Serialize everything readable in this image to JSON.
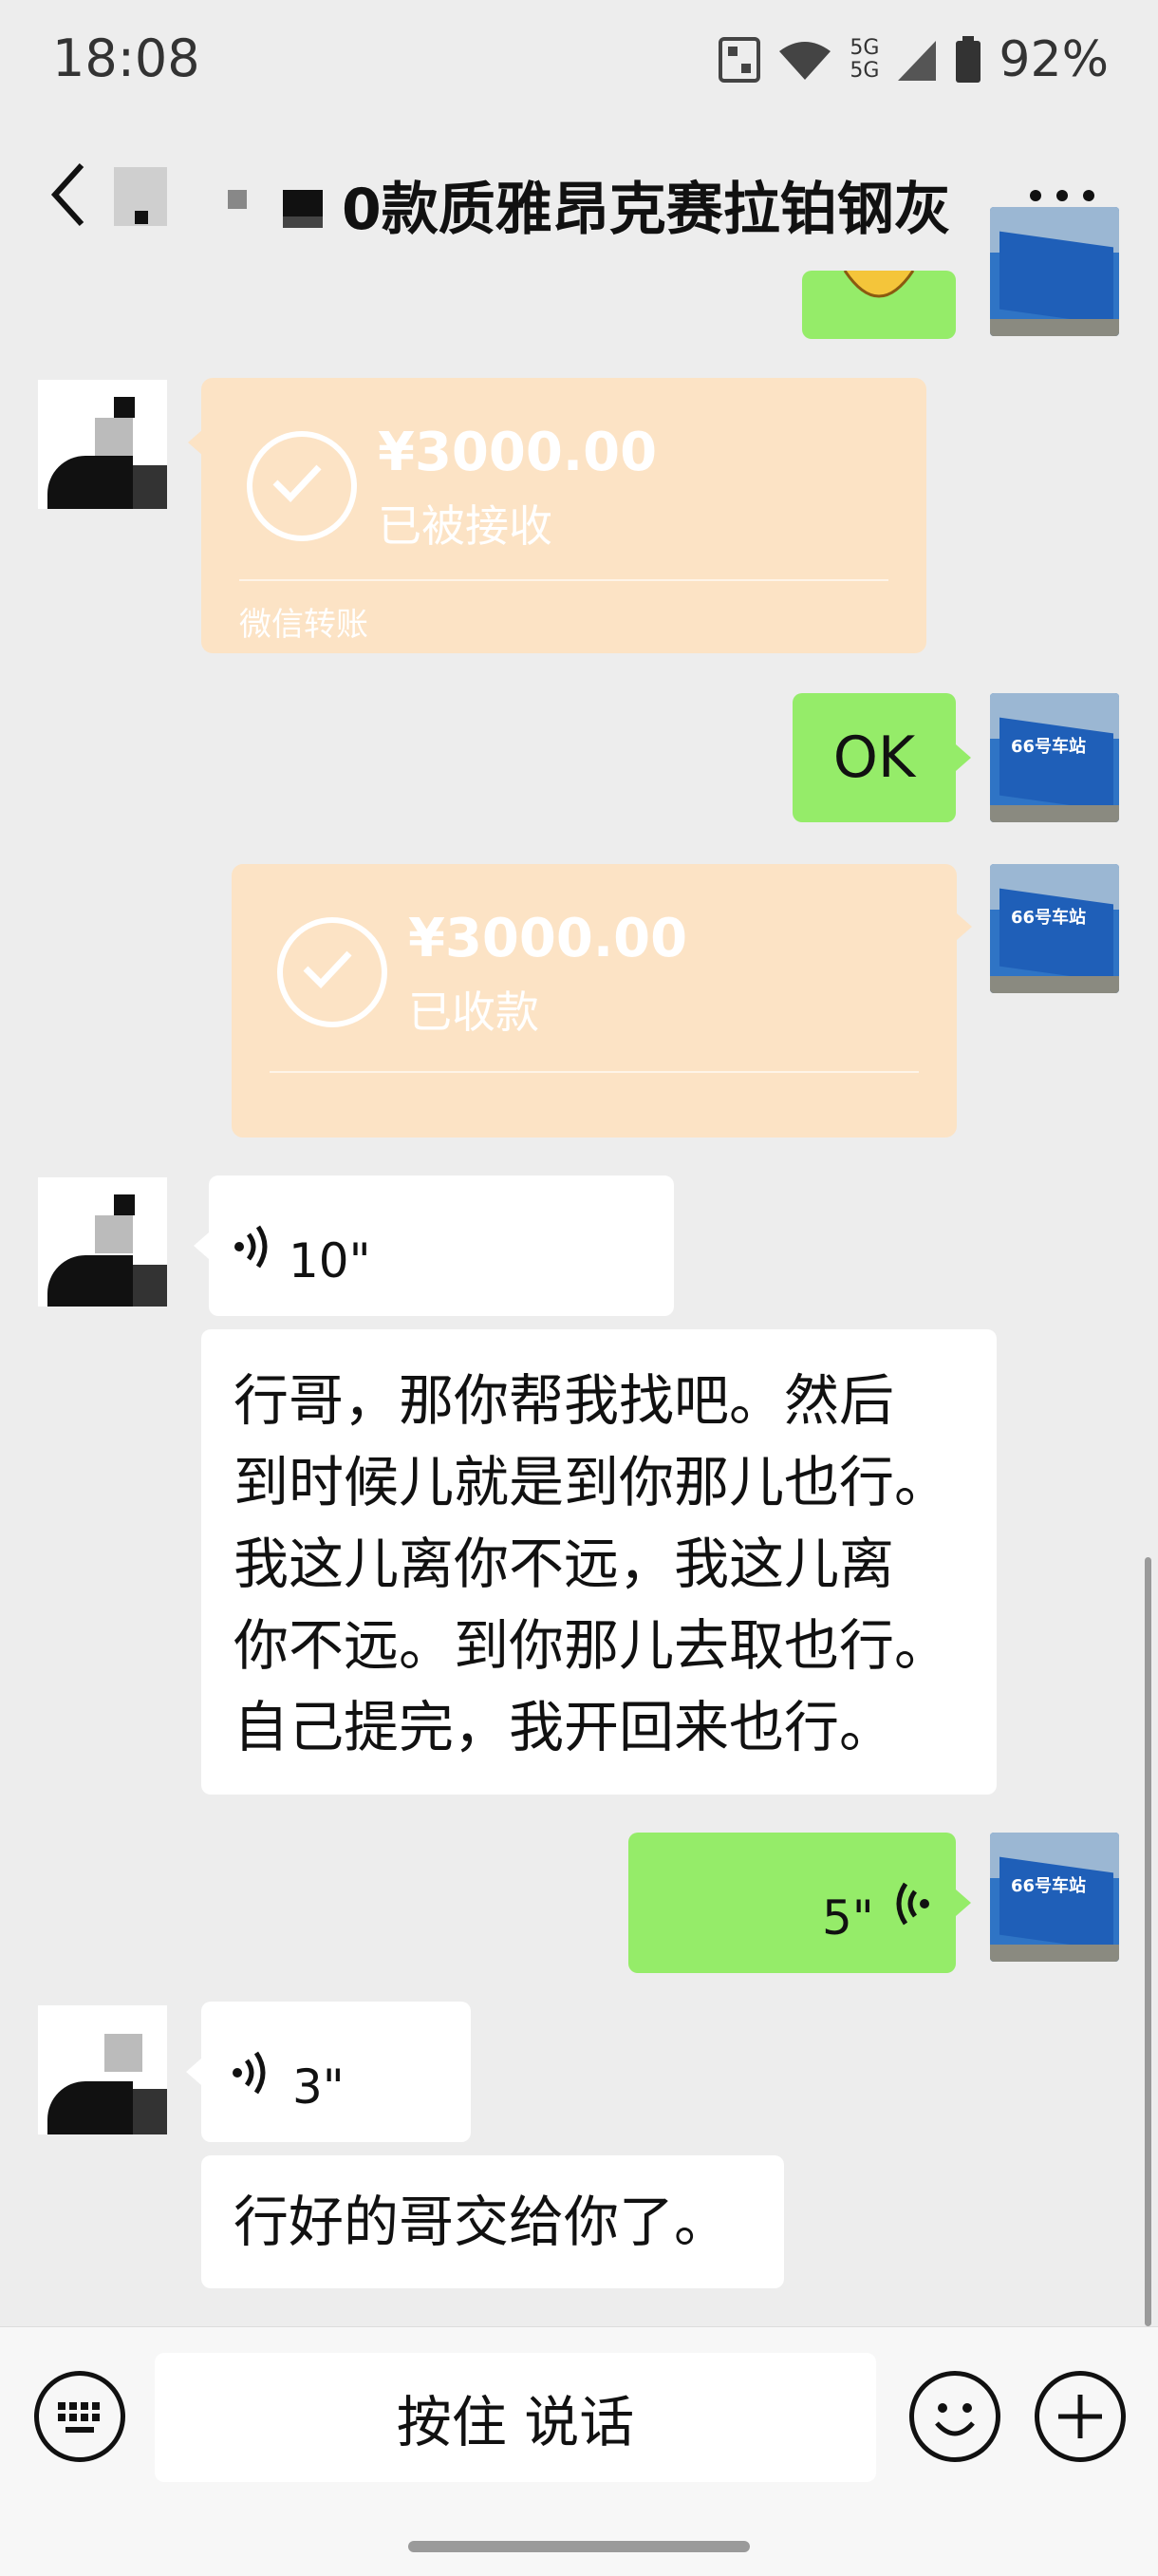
{
  "status_bar": {
    "time": "18:08",
    "battery": "92%",
    "network_label_top": "5G",
    "network_label_bottom": "5G"
  },
  "header": {
    "title": "0款质雅昂克赛拉铂钢灰"
  },
  "messages": [
    {
      "type": "transfer",
      "side": "left",
      "amount": "¥3000.00",
      "status": "已被接收",
      "source": "微信转账"
    },
    {
      "type": "text",
      "side": "right",
      "text": "OK"
    },
    {
      "type": "transfer",
      "side": "right",
      "amount": "¥3000.00",
      "status": "已收款"
    },
    {
      "type": "voice",
      "side": "left",
      "duration": "10\""
    },
    {
      "type": "text",
      "side": "left",
      "lines": [
        "行哥，那你帮我找吧。然后",
        "到时候儿就是到你那儿也行。",
        "我这儿离你不远，我这儿离",
        "你不远。到你那儿去取也行。",
        "自己提完，我开回来也行。"
      ]
    },
    {
      "type": "voice",
      "side": "right",
      "duration": "5\""
    },
    {
      "type": "voice",
      "side": "left",
      "duration": "3\""
    },
    {
      "type": "text",
      "side": "left",
      "text": "行好的哥交给你了。"
    }
  ],
  "my_avatar": {
    "sign_text": "66号车站",
    "color": "#2f74c5"
  },
  "input_bar": {
    "hold_to_talk": "按住 说话"
  },
  "icons": [
    "back-icon",
    "more-icon",
    "wifi-icon",
    "signal-icon",
    "battery-icon",
    "keyboard-icon",
    "emoji-icon",
    "plus-icon",
    "voice-wave-icon",
    "check-icon"
  ],
  "colors": {
    "bubble_green": "#95ec69",
    "transfer_orange": "#fce3c5",
    "background": "#ededed"
  }
}
